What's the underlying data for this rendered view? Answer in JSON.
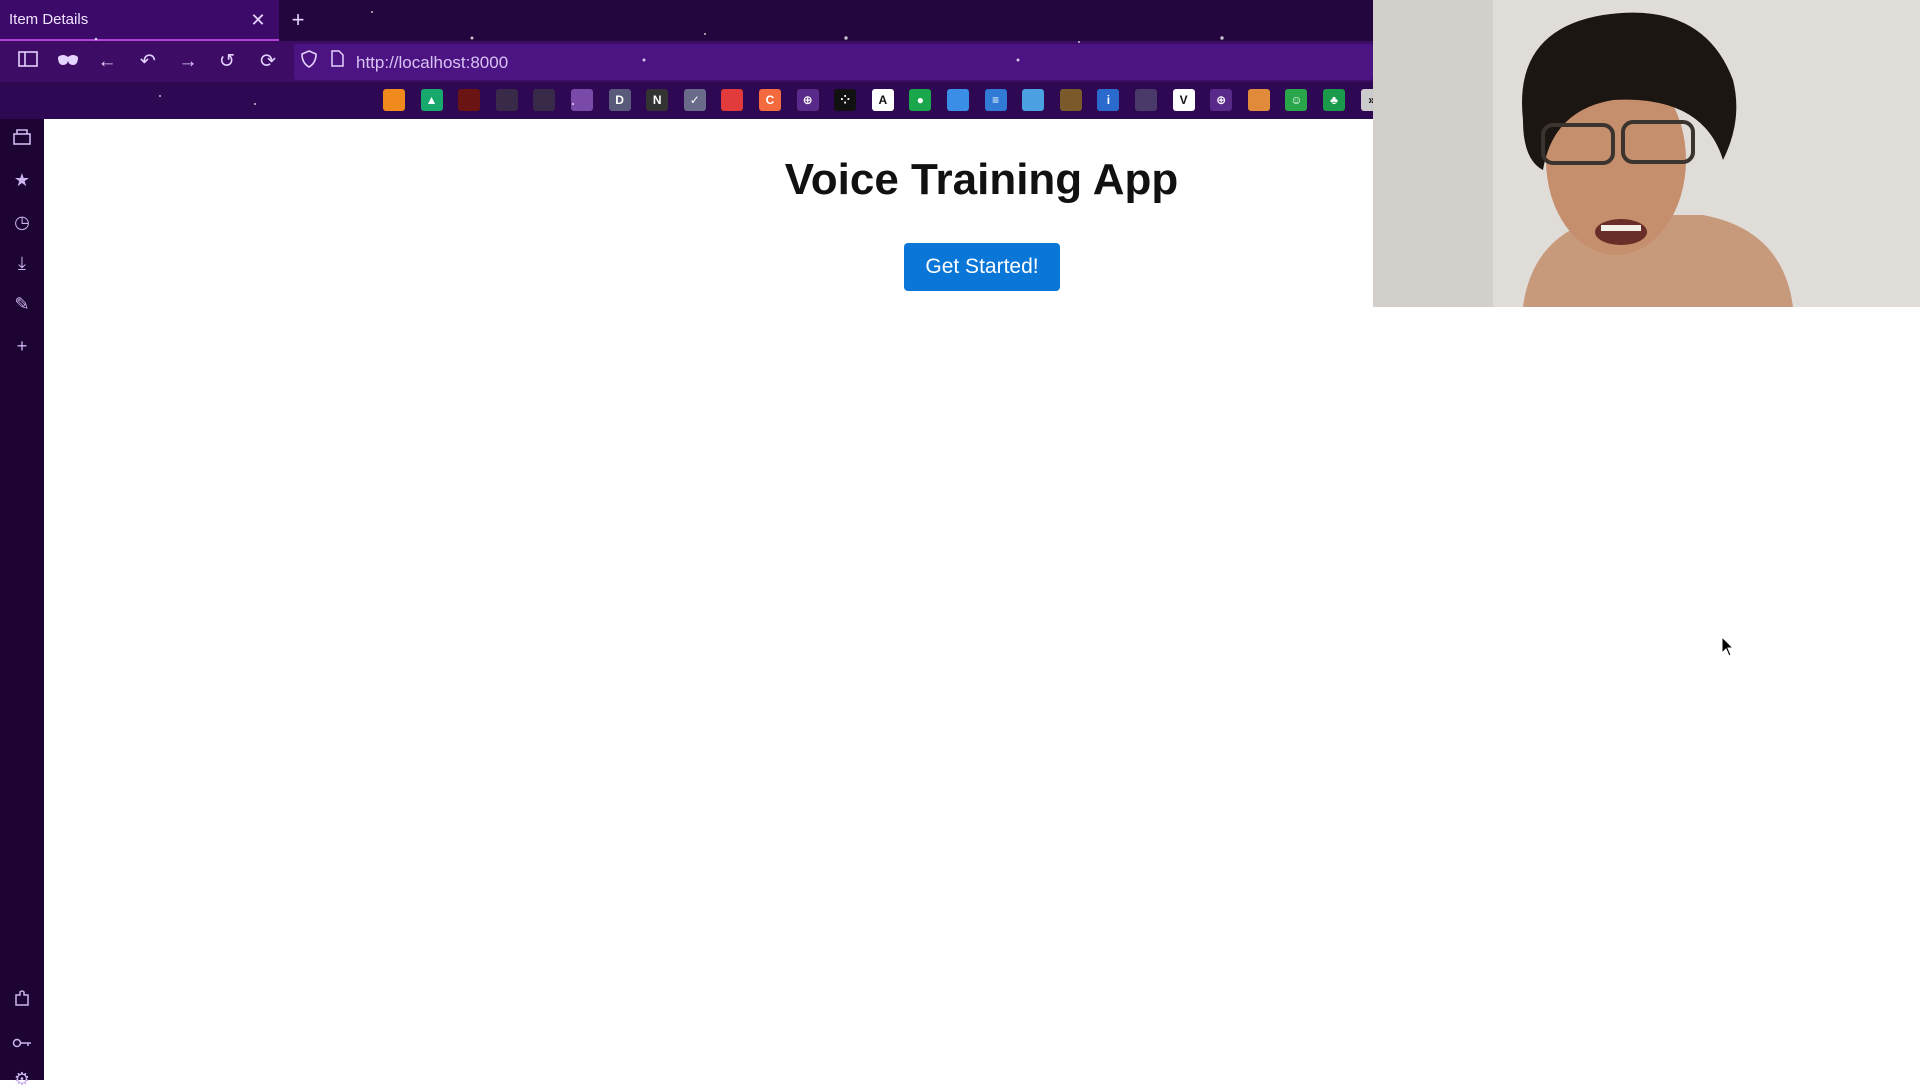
{
  "browser": {
    "tab_title": "Item Details",
    "tab_close_icon": "close-icon",
    "new_tab_icon": "plus-icon",
    "url": "http://localhost:8000",
    "colors": {
      "titlebar": "#24063f",
      "navbar": "#3d0d66",
      "accent": "#b23fd6"
    }
  },
  "nav_buttons": [
    "sidebar-toggle-icon",
    "private-mask-icon",
    "back-icon",
    "undo-icon",
    "forward-icon",
    "history-icon",
    "reload-icon"
  ],
  "bookmarks": [
    {
      "icon": "leaf-favicon",
      "color": "#f08a1c",
      "glyph": ""
    },
    {
      "icon": "triangle-favicon",
      "color": "#17a86b",
      "glyph": "▲"
    },
    {
      "icon": "red-box-favicon",
      "color": "#6b1414",
      "glyph": ""
    },
    {
      "icon": "github-favicon",
      "color": "#3a2a4a",
      "glyph": ""
    },
    {
      "icon": "github-favicon-2",
      "color": "#3a2a4a",
      "glyph": ""
    },
    {
      "icon": "cup-favicon",
      "color": "#7a4aa8",
      "glyph": ""
    },
    {
      "icon": "dsg-favicon",
      "color": "#5a5a7a",
      "glyph": "D"
    },
    {
      "icon": "n-favicon",
      "color": "#333333",
      "glyph": "N"
    },
    {
      "icon": "check-favicon",
      "color": "#6a6a8a",
      "glyph": "✓"
    },
    {
      "icon": "flag-favicon",
      "color": "#e23b3b",
      "glyph": ""
    },
    {
      "icon": "orange-c-favicon",
      "color": "#f26a3d",
      "glyph": "C"
    },
    {
      "icon": "globe-favicon",
      "color": "#5a2a8a",
      "glyph": "⊕"
    },
    {
      "icon": "dots-favicon",
      "color": "#111111",
      "glyph": "⁘"
    },
    {
      "icon": "a-favicon",
      "color": "#ffffff",
      "glyph": "A"
    },
    {
      "icon": "green-dot-favicon",
      "color": "#1aa64a",
      "glyph": "●"
    },
    {
      "icon": "blue-circle-favicon",
      "color": "#3a8ee6",
      "glyph": ""
    },
    {
      "icon": "blue-square-favicon",
      "color": "#2f7bd6",
      "glyph": "≡"
    },
    {
      "icon": "swirl-favicon",
      "color": "#4aa0e0",
      "glyph": ""
    },
    {
      "icon": "mona-lisa-favicon",
      "color": "#7a5a2a",
      "glyph": ""
    },
    {
      "icon": "ibb-favicon",
      "color": "#2a6acc",
      "glyph": "i"
    },
    {
      "icon": "ball-favicon",
      "color": "#4a3a6a",
      "glyph": ""
    },
    {
      "icon": "v-favicon",
      "color": "#ffffff",
      "glyph": "V"
    },
    {
      "icon": "globe-favicon-2",
      "color": "#5a2a8a",
      "glyph": "⊕"
    },
    {
      "icon": "cat-favicon",
      "color": "#e08a3a",
      "glyph": ""
    },
    {
      "icon": "smiley-favicon",
      "color": "#2aa64a",
      "glyph": "☺"
    },
    {
      "icon": "leaf-clover-favicon",
      "color": "#1a9a4a",
      "glyph": "♣"
    },
    {
      "icon": "overflow-favicon",
      "color": "#cccccc",
      "glyph": "»"
    }
  ],
  "sidebar_icons_top": [
    "tray-icon",
    "star-icon",
    "clock-icon",
    "download-icon",
    "pencil-icon",
    "plus-icon"
  ],
  "sidebar_icons_bottom": [
    "extension-icon",
    "key-icon",
    "settings-icon"
  ],
  "page": {
    "title": "Voice Training App",
    "button_label": "Get Started!",
    "button_color": "#0a77d8"
  },
  "webcam": {
    "icon": "webcam-person"
  }
}
